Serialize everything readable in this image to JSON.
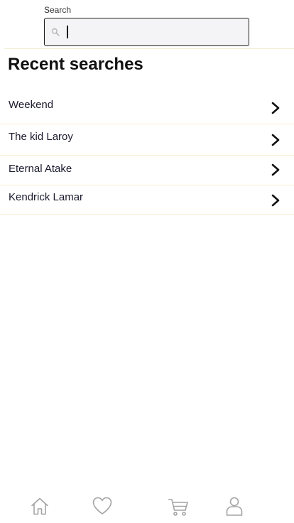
{
  "search": {
    "label": "Search",
    "value": "",
    "placeholder": "",
    "icon": "search-icon"
  },
  "recent": {
    "title": "Recent searches",
    "items": [
      {
        "label": "Weekend",
        "icon": "chevron-right-icon"
      },
      {
        "label": "The kid Laroy",
        "icon": "chevron-right-icon"
      },
      {
        "label": "Eternal Atake",
        "icon": "chevron-right-icon"
      },
      {
        "label": "Kendrick Lamar",
        "icon": "chevron-right-icon"
      }
    ]
  },
  "tabbar": {
    "tabs": [
      {
        "icon": "home-icon"
      },
      {
        "icon": "heart-icon"
      },
      {
        "icon": "cart-icon"
      },
      {
        "icon": "profile-icon"
      }
    ]
  },
  "colors": {
    "divider": "#f3efd2",
    "field_bg": "#f4f4f6",
    "field_border": "#1f1f1f",
    "icon_gray": "#9a9a9a",
    "text": "#111111"
  }
}
